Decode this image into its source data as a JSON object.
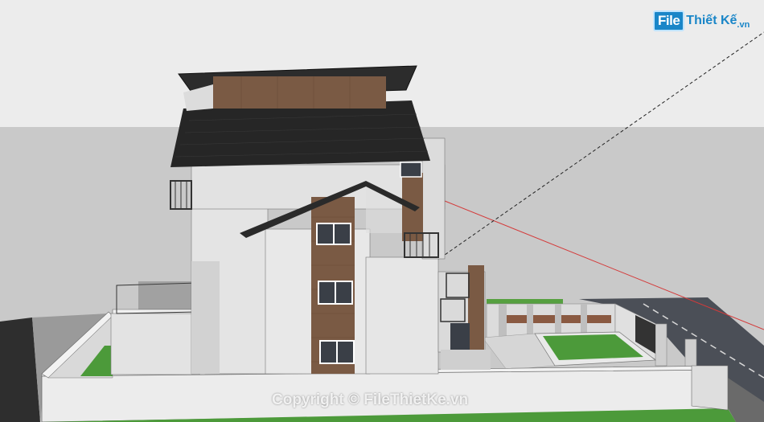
{
  "watermark": {
    "logo_box": "File",
    "logo_rest": "Thiết Kế",
    "logo_tld": ".vn",
    "copyright": "Copyright © FileThietKe.vn"
  },
  "colors": {
    "sky": "#ececec",
    "ground": "#c8c8c8",
    "wall": "#e2e2e2",
    "wall_shadow": "#d0d0d0",
    "roof": "#222222",
    "wood": "#7a5a44",
    "lawn": "#4c9a3a",
    "road": "#4a4d55",
    "brand": "#1a86c8"
  }
}
